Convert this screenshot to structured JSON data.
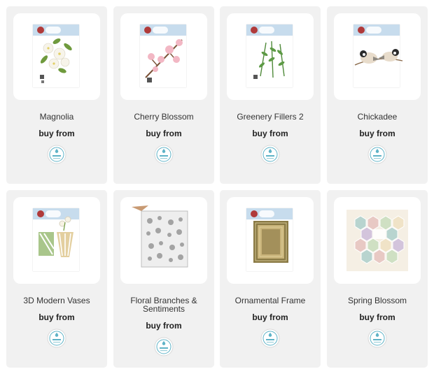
{
  "products": [
    {
      "title": "Magnolia",
      "buy_label": "buy from",
      "image_icon": "magnolia-die-pack",
      "retailer_icon": "elizabeth-craft-designs-badge"
    },
    {
      "title": "Cherry Blossom",
      "buy_label": "buy from",
      "image_icon": "cherry-blossom-die-pack",
      "retailer_icon": "elizabeth-craft-designs-badge"
    },
    {
      "title": "Greenery Fillers 2",
      "buy_label": "buy from",
      "image_icon": "greenery-die-pack",
      "retailer_icon": "elizabeth-craft-designs-badge"
    },
    {
      "title": "Chickadee",
      "buy_label": "buy from",
      "image_icon": "chickadee-die-pack",
      "retailer_icon": "elizabeth-craft-designs-badge"
    },
    {
      "title": "3D Modern Vases",
      "buy_label": "buy from",
      "image_icon": "vases-die-pack",
      "retailer_icon": "elizabeth-craft-designs-badge"
    },
    {
      "title": "Floral Branches & Sentiments",
      "buy_label": "buy from",
      "image_icon": "stamp-set",
      "retailer_icon": "elizabeth-craft-designs-badge"
    },
    {
      "title": "Ornamental Frame",
      "buy_label": "buy from",
      "image_icon": "frame-die-pack",
      "retailer_icon": "elizabeth-craft-designs-badge"
    },
    {
      "title": "Spring Blossom",
      "buy_label": "buy from",
      "image_icon": "paper-pad",
      "retailer_icon": "elizabeth-craft-designs-badge"
    }
  ],
  "colors": {
    "card_bg": "#f1f1f1",
    "thumb_bg": "#ffffff",
    "banner_blue": "#c7dced",
    "badge_teal": "#5fb3c7"
  }
}
